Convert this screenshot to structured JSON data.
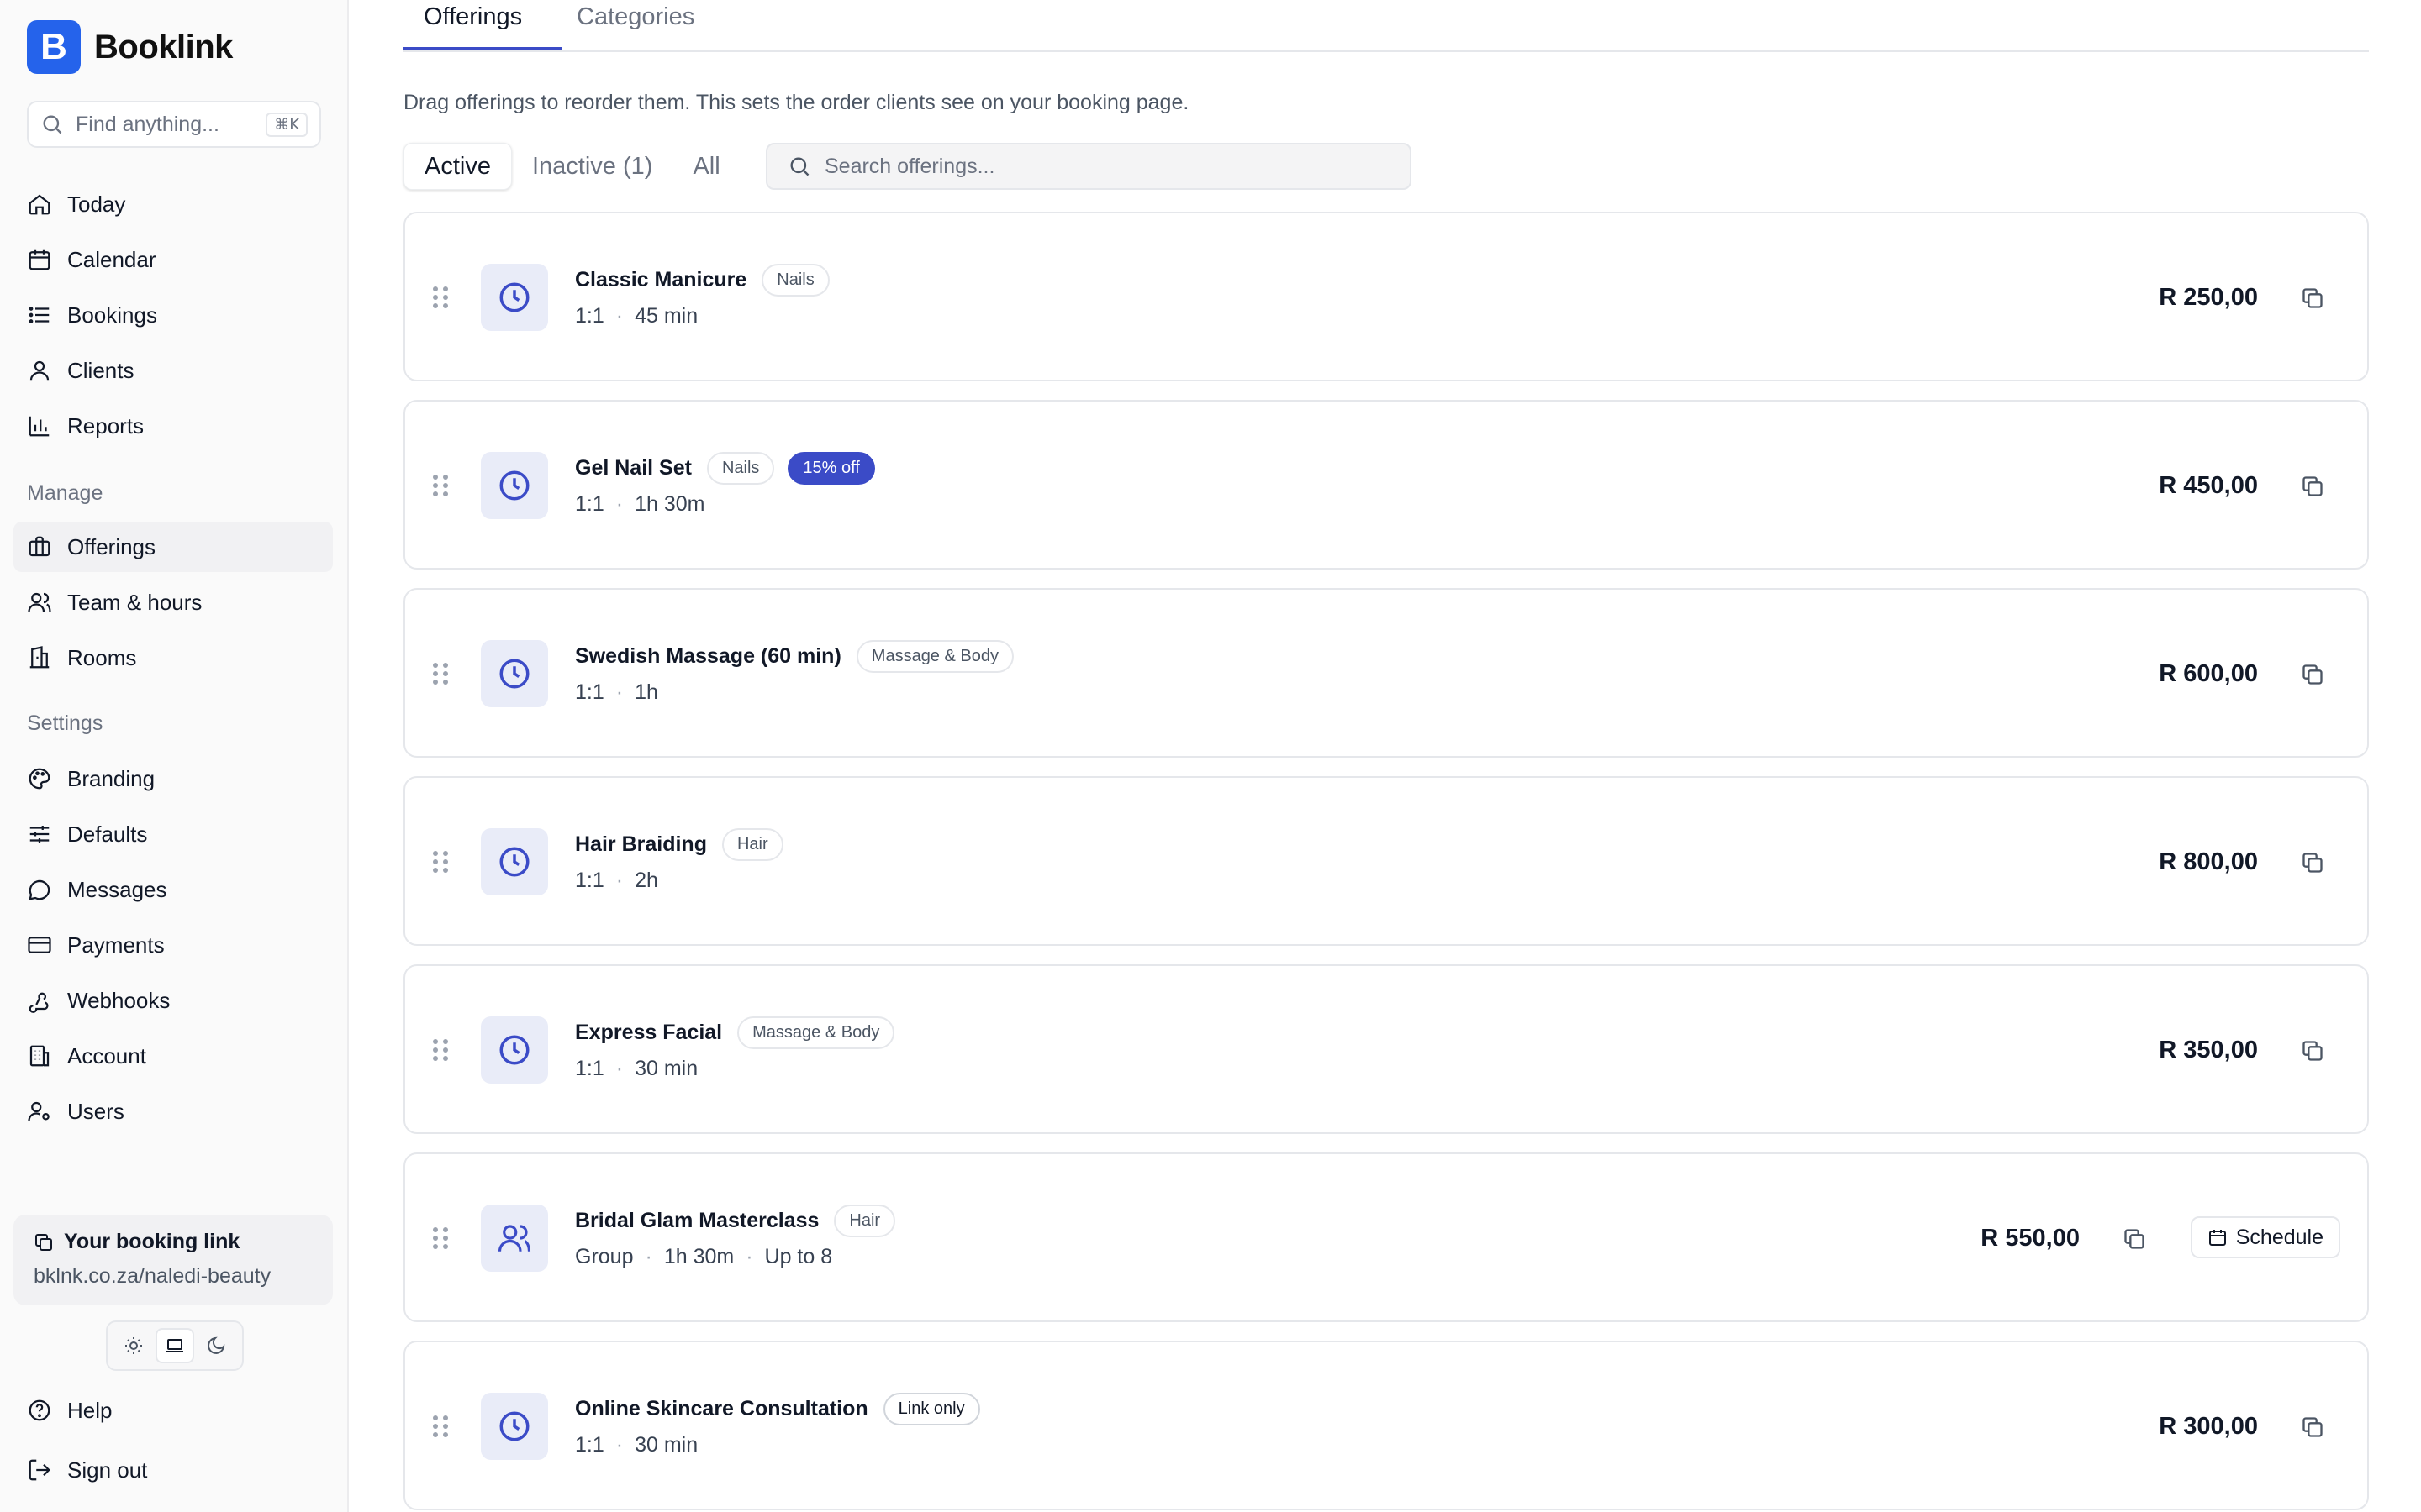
{
  "app": {
    "name": "Booklink",
    "logo_letter": "B"
  },
  "search": {
    "placeholder": "Find anything...",
    "shortcut": "⌘K"
  },
  "nav": {
    "primary": [
      {
        "label": "Today",
        "icon": "home-icon"
      },
      {
        "label": "Calendar",
        "icon": "calendar-icon"
      },
      {
        "label": "Bookings",
        "icon": "list-icon"
      },
      {
        "label": "Clients",
        "icon": "user-icon"
      },
      {
        "label": "Reports",
        "icon": "bar-chart-icon"
      }
    ],
    "manage_label": "Manage",
    "manage": [
      {
        "label": "Offerings",
        "icon": "briefcase-icon",
        "active": true
      },
      {
        "label": "Team & hours",
        "icon": "users-icon"
      },
      {
        "label": "Rooms",
        "icon": "building-icon"
      }
    ],
    "settings_label": "Settings",
    "settings": [
      {
        "label": "Branding",
        "icon": "palette-icon"
      },
      {
        "label": "Defaults",
        "icon": "sliders-icon"
      },
      {
        "label": "Messages",
        "icon": "message-icon"
      },
      {
        "label": "Payments",
        "icon": "credit-card-icon"
      },
      {
        "label": "Webhooks",
        "icon": "webhook-icon"
      },
      {
        "label": "Account",
        "icon": "office-icon"
      },
      {
        "label": "Users",
        "icon": "user-cog-icon"
      }
    ],
    "footer": [
      {
        "label": "Help",
        "icon": "help-icon"
      },
      {
        "label": "Sign out",
        "icon": "sign-out-icon"
      }
    ]
  },
  "booking_link": {
    "title": "Your booking link",
    "url": "bklnk.co.za/naledi-beauty"
  },
  "theme": {
    "options": [
      "light",
      "system",
      "dark"
    ],
    "selected": "system"
  },
  "tabs": [
    {
      "label": "Offerings",
      "active": true
    },
    {
      "label": "Categories",
      "active": false
    }
  ],
  "hint": "Drag offerings to reorder them. This sets the order clients see on your booking page.",
  "filters": [
    {
      "label": "Active",
      "active": true
    },
    {
      "label": "Inactive (1)",
      "active": false
    },
    {
      "label": "All",
      "active": false
    }
  ],
  "offer_search": {
    "placeholder": "Search offerings..."
  },
  "accent_color": "#3b4bc7",
  "offerings": [
    {
      "name": "Classic Manicure",
      "badges": [
        "Nails"
      ],
      "promo": "",
      "type": "1:1",
      "duration": "45 min",
      "capacity": "",
      "price": "R 250,00",
      "icon": "clock-icon",
      "schedule": ""
    },
    {
      "name": "Gel Nail Set",
      "badges": [
        "Nails"
      ],
      "promo": "15% off",
      "type": "1:1",
      "duration": "1h 30m",
      "capacity": "",
      "price": "R 450,00",
      "icon": "clock-icon",
      "schedule": ""
    },
    {
      "name": "Swedish Massage (60 min)",
      "badges": [
        "Massage & Body"
      ],
      "promo": "",
      "type": "1:1",
      "duration": "1h",
      "capacity": "",
      "price": "R 600,00",
      "icon": "clock-icon",
      "schedule": ""
    },
    {
      "name": "Hair Braiding",
      "badges": [
        "Hair"
      ],
      "promo": "",
      "type": "1:1",
      "duration": "2h",
      "capacity": "",
      "price": "R 800,00",
      "icon": "clock-icon",
      "schedule": ""
    },
    {
      "name": "Express Facial",
      "badges": [
        "Massage & Body"
      ],
      "promo": "",
      "type": "1:1",
      "duration": "30 min",
      "capacity": "",
      "price": "R 350,00",
      "icon": "clock-icon",
      "schedule": ""
    },
    {
      "name": "Bridal Glam Masterclass",
      "badges": [
        "Hair"
      ],
      "promo": "",
      "type": "Group",
      "duration": "1h 30m",
      "capacity": "Up to 8",
      "price": "R 550,00",
      "icon": "users-icon",
      "schedule": "Schedule"
    },
    {
      "name": "Online Skincare Consultation",
      "badges": [],
      "link_badge": "Link only",
      "promo": "",
      "type": "1:1",
      "duration": "30 min",
      "capacity": "",
      "price": "R 300,00",
      "icon": "clock-icon",
      "schedule": ""
    }
  ]
}
